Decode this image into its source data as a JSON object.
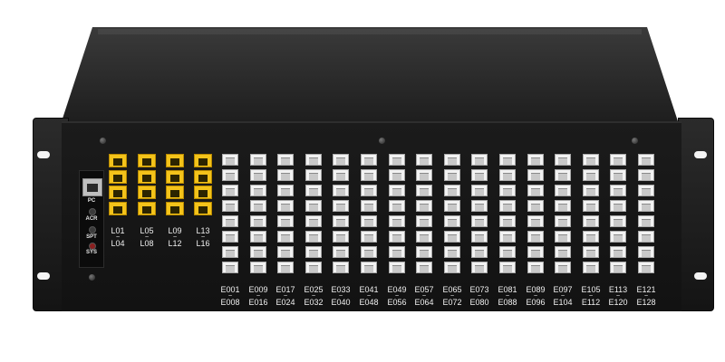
{
  "device": {
    "control_labels": [
      "PC",
      "ACR",
      "SPT",
      "SYS"
    ],
    "line_group_labels": [
      {
        "from": "L01",
        "to": "L04"
      },
      {
        "from": "L05",
        "to": "L08"
      },
      {
        "from": "L09",
        "to": "L12"
      },
      {
        "from": "L13",
        "to": "L16"
      }
    ],
    "extension_group_labels": [
      {
        "from": "E001",
        "to": "E008"
      },
      {
        "from": "E009",
        "to": "E016"
      },
      {
        "from": "E017",
        "to": "E024"
      },
      {
        "from": "E025",
        "to": "E032"
      },
      {
        "from": "E033",
        "to": "E040"
      },
      {
        "from": "E041",
        "to": "E048"
      },
      {
        "from": "E049",
        "to": "E056"
      },
      {
        "from": "E057",
        "to": "E064"
      },
      {
        "from": "E065",
        "to": "E072"
      },
      {
        "from": "E073",
        "to": "E080"
      },
      {
        "from": "E081",
        "to": "E088"
      },
      {
        "from": "E089",
        "to": "E096"
      },
      {
        "from": "E097",
        "to": "E104"
      },
      {
        "from": "E105",
        "to": "E112"
      },
      {
        "from": "E113",
        "to": "E120"
      },
      {
        "from": "E121",
        "to": "E128"
      }
    ],
    "range_separator": "~",
    "colors": {
      "chassis": "#1a1a1a",
      "line_port": "#f4c31a",
      "extension_port": "#f2f2f2",
      "label_text": "#f0f0f0"
    }
  }
}
